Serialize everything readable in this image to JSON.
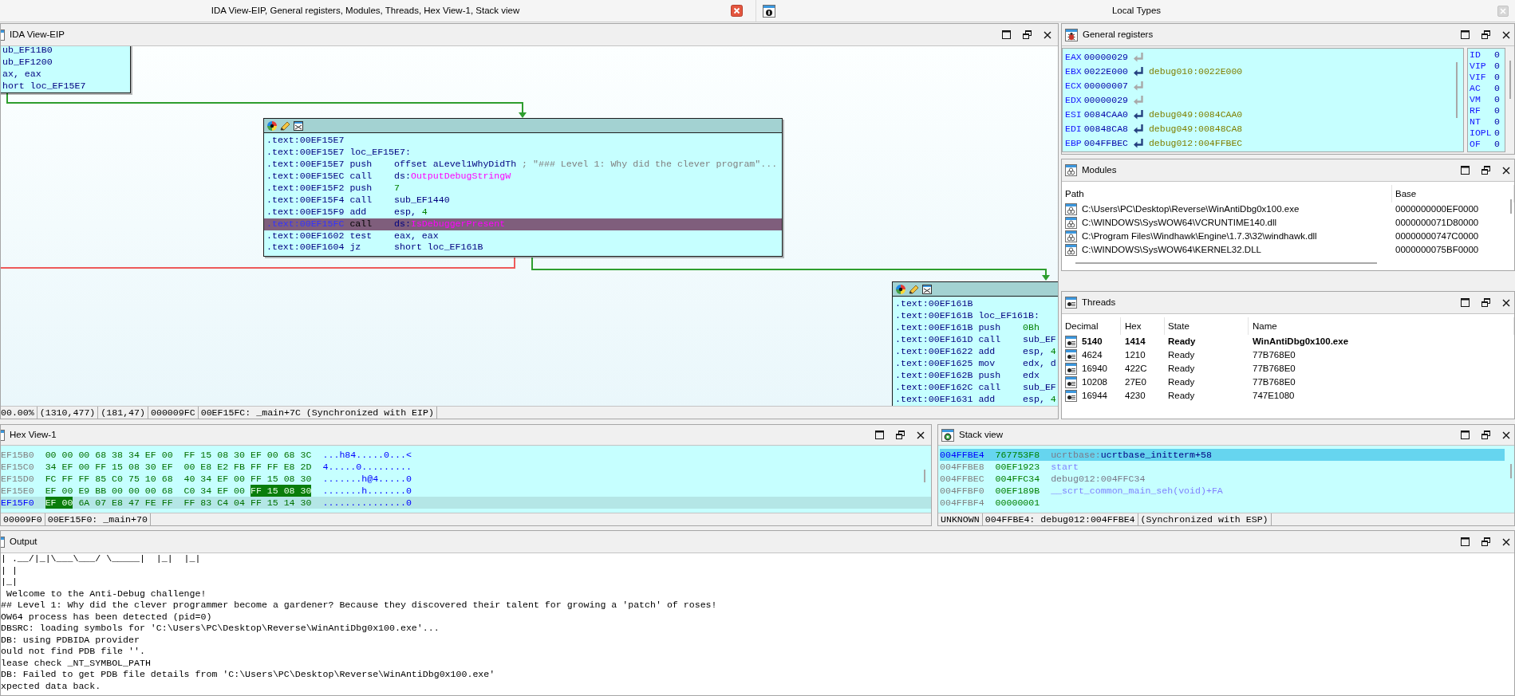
{
  "title_bar": {
    "title": "IDA View-EIP, General registers, Modules, Threads, Hex View-1, Stack view"
  },
  "local_types_bar": {
    "title": "Local Types"
  },
  "ida_view": {
    "title": "IDA View-EIP",
    "nodes": [
      {
        "kind": "clipped",
        "lines": [
          {
            "operands": [
              {
                "text": "ub_EF11B0",
                "kind": "name"
              }
            ],
            "selected": false
          },
          {
            "operands": [
              {
                "text": "ub_EF1200",
                "kind": "name"
              }
            ],
            "selected": false
          },
          {
            "operands": [
              {
                "text": "ax, eax",
                "kind": "name"
              }
            ],
            "selected": false
          },
          {
            "operands": [
              {
                "text": "hort loc_EF15E7",
                "kind": "name"
              }
            ],
            "selected": false
          }
        ]
      },
      {
        "kind": "block",
        "lines": [
          {
            "address": ".text:00EF15E7",
            "selected": false
          },
          {
            "address": ".text:00EF15E7",
            "label": "loc_EF15E7:",
            "selected": false
          },
          {
            "address": ".text:00EF15E7",
            "mnemonic": "push",
            "operands": [
              {
                "text": "offset aLevel1WhyDidTh",
                "kind": "name"
              }
            ],
            "comment": "; \"### Level 1: Why did the clever program\"...",
            "selected": false
          },
          {
            "address": ".text:00EF15EC",
            "mnemonic": "call",
            "operands": [
              {
                "text": "ds:",
                "kind": "name"
              },
              {
                "text": "OutputDebugStringW",
                "kind": "import"
              }
            ],
            "selected": false
          },
          {
            "address": ".text:00EF15F2",
            "mnemonic": "push",
            "operands": [
              {
                "text": "7",
                "kind": "number"
              }
            ],
            "selected": false
          },
          {
            "address": ".text:00EF15F4",
            "mnemonic": "call",
            "operands": [
              {
                "text": "sub_EF1440",
                "kind": "name"
              }
            ],
            "selected": false
          },
          {
            "address": ".text:00EF15F9",
            "mnemonic": "add",
            "operands": [
              {
                "text": "esp, ",
                "kind": "name"
              },
              {
                "text": "4",
                "kind": "number"
              }
            ],
            "selected": false
          },
          {
            "address": ".text:00EF15FC",
            "mnemonic": "call",
            "operands": [
              {
                "text": "ds:",
                "kind": "name"
              },
              {
                "text": "IsDebuggerPresent",
                "kind": "import"
              }
            ],
            "selected": true
          },
          {
            "address": ".text:00EF1602",
            "mnemonic": "test",
            "operands": [
              {
                "text": "eax, eax",
                "kind": "name"
              }
            ],
            "selected": false
          },
          {
            "address": ".text:00EF1604",
            "mnemonic": "jz",
            "operands": [
              {
                "text": "short loc_EF161B",
                "kind": "name"
              }
            ],
            "selected": false
          }
        ]
      },
      {
        "kind": "block",
        "lines": [
          {
            "address": ".text:00EF161B",
            "selected": false
          },
          {
            "address": ".text:00EF161B",
            "label": "loc_EF161B:",
            "selected": false
          },
          {
            "address": ".text:00EF161B",
            "mnemonic": "push",
            "operands": [
              {
                "text": "0Bh",
                "kind": "number"
              }
            ],
            "selected": false
          },
          {
            "address": ".text:00EF161D",
            "mnemonic": "call",
            "operands": [
              {
                "text": "sub_EF",
                "kind": "name"
              }
            ],
            "selected": false
          },
          {
            "address": ".text:00EF1622",
            "mnemonic": "add",
            "operands": [
              {
                "text": "esp, ",
                "kind": "name"
              },
              {
                "text": "4",
                "kind": "number"
              }
            ],
            "selected": false
          },
          {
            "address": ".text:00EF1625",
            "mnemonic": "mov",
            "operands": [
              {
                "text": "edx, d",
                "kind": "name"
              }
            ],
            "selected": false
          },
          {
            "address": ".text:00EF162B",
            "mnemonic": "push",
            "operands": [
              {
                "text": "edx",
                "kind": "name"
              }
            ],
            "selected": false
          },
          {
            "address": ".text:00EF162C",
            "mnemonic": "call",
            "operands": [
              {
                "text": "sub_EF",
                "kind": "name"
              }
            ],
            "selected": false
          },
          {
            "address": ".text:00EF1631",
            "mnemonic": "add",
            "operands": [
              {
                "text": "esp, ",
                "kind": "name"
              },
              {
                "text": "4",
                "kind": "number"
              }
            ],
            "selected": false
          }
        ]
      }
    ],
    "edges": [
      {
        "kind": "arrow",
        "color": "#2e9e2e"
      },
      {
        "kind": "line",
        "color": "#ee5a5a"
      },
      {
        "kind": "arrow",
        "color": "#2e9e2e"
      }
    ],
    "status_bar": [
      "00.00%",
      "(1310,477)",
      "(181,47)",
      "000009FC",
      "00EF15FC: _main+7C (Synchronized with EIP)"
    ]
  },
  "general_registers": {
    "title": "General registers",
    "registers": [
      {
        "name": "EAX",
        "value": "00000029",
        "disabled": true
      },
      {
        "name": "EBX",
        "value": "0022E000",
        "disabled": false,
        "target": "debug010:0022E000"
      },
      {
        "name": "ECX",
        "value": "00000007",
        "disabled": true
      },
      {
        "name": "EDX",
        "value": "00000029",
        "disabled": true
      },
      {
        "name": "ESI",
        "value": "0084CAA0",
        "disabled": false,
        "target": "debug049:0084CAA0"
      },
      {
        "name": "EDI",
        "value": "00848CA8",
        "disabled": false,
        "target": "debug049:00848CA8"
      },
      {
        "name": "EBP",
        "value": "004FFBEC",
        "disabled": false,
        "target": "debug012:004FFBEC"
      }
    ],
    "flags": [
      {
        "name": "ID",
        "value": "0"
      },
      {
        "name": "VIP",
        "value": "0"
      },
      {
        "name": "VIF",
        "value": "0"
      },
      {
        "name": "AC",
        "value": "0"
      },
      {
        "name": "VM",
        "value": "0"
      },
      {
        "name": "RF",
        "value": "0"
      },
      {
        "name": "NT",
        "value": "0"
      },
      {
        "name": "IOPL",
        "value": "0"
      },
      {
        "name": "OF",
        "value": "0"
      }
    ]
  },
  "modules": {
    "title": "Modules",
    "columns": [
      "Path",
      "Base"
    ],
    "rows": [
      {
        "path": "C:\\Users\\PC\\Desktop\\Reverse\\WinAntiDbg0x100.exe",
        "base": "0000000000EF0000"
      },
      {
        "path": "C:\\WINDOWS\\SysWOW64\\VCRUNTIME140.dll",
        "base": "0000000071D80000"
      },
      {
        "path": "C:\\Program Files\\Windhawk\\Engine\\1.7.3\\32\\windhawk.dll",
        "base": "00000000747C0000"
      },
      {
        "path": "C:\\WINDOWS\\SysWOW64\\KERNEL32.DLL",
        "base": "0000000075BF0000"
      }
    ]
  },
  "threads": {
    "title": "Threads",
    "columns": [
      "Decimal",
      "Hex",
      "State",
      "Name"
    ],
    "rows": [
      {
        "decimal": "5140",
        "hex": "1414",
        "state": "Ready",
        "name": "WinAntiDbg0x100.exe",
        "current": true
      },
      {
        "decimal": "4624",
        "hex": "1210",
        "state": "Ready",
        "name": "77B768E0",
        "current": false
      },
      {
        "decimal": "16940",
        "hex": "422C",
        "state": "Ready",
        "name": "77B768E0",
        "current": false
      },
      {
        "decimal": "10208",
        "hex": "27E0",
        "state": "Ready",
        "name": "77B768E0",
        "current": false
      },
      {
        "decimal": "16944",
        "hex": "4230",
        "state": "Ready",
        "name": "747E1080",
        "current": false
      }
    ]
  },
  "hex_view": {
    "title": "Hex View-1",
    "rows": [
      {
        "address": "EF15B0",
        "selected": false,
        "ascii": "...h84.....0...<",
        "bytes": [
          {
            "text": "00",
            "highlighted": false
          },
          {
            "text": "00",
            "highlighted": false
          },
          {
            "text": "00",
            "highlighted": false
          },
          {
            "text": "68",
            "highlighted": false
          },
          {
            "text": "38",
            "highlighted": false
          },
          {
            "text": "34",
            "highlighted": false
          },
          {
            "text": "EF",
            "highlighted": false
          },
          {
            "text": "00",
            "highlighted": false
          },
          {
            "text": "FF",
            "highlighted": false
          },
          {
            "text": "15",
            "highlighted": false
          },
          {
            "text": "08",
            "highlighted": false
          },
          {
            "text": "30",
            "highlighted": false
          },
          {
            "text": "EF",
            "highlighted": false
          },
          {
            "text": "00",
            "highlighted": false
          },
          {
            "text": "68",
            "highlighted": false
          },
          {
            "text": "3C",
            "highlighted": false
          }
        ]
      },
      {
        "address": "EF15C0",
        "selected": false,
        "ascii": "4.....0.........",
        "bytes": [
          {
            "text": "34",
            "highlighted": false
          },
          {
            "text": "EF",
            "highlighted": false
          },
          {
            "text": "00",
            "highlighted": false
          },
          {
            "text": "FF",
            "highlighted": false
          },
          {
            "text": "15",
            "highlighted": false
          },
          {
            "text": "08",
            "highlighted": false
          },
          {
            "text": "30",
            "highlighted": false
          },
          {
            "text": "EF",
            "highlighted": false
          },
          {
            "text": "00",
            "highlighted": false
          },
          {
            "text": "E8",
            "highlighted": false
          },
          {
            "text": "E2",
            "highlighted": false
          },
          {
            "text": "FB",
            "highlighted": false
          },
          {
            "text": "FF",
            "highlighted": false
          },
          {
            "text": "FF",
            "highlighted": false
          },
          {
            "text": "E8",
            "highlighted": false
          },
          {
            "text": "2D",
            "highlighted": false
          }
        ]
      },
      {
        "address": "EF15D0",
        "selected": false,
        "ascii": ".......h@4.....0",
        "bytes": [
          {
            "text": "FC",
            "highlighted": false
          },
          {
            "text": "FF",
            "highlighted": false
          },
          {
            "text": "FF",
            "highlighted": false
          },
          {
            "text": "85",
            "highlighted": false
          },
          {
            "text": "C0",
            "highlighted": false
          },
          {
            "text": "75",
            "highlighted": false
          },
          {
            "text": "10",
            "highlighted": false
          },
          {
            "text": "68",
            "highlighted": false
          },
          {
            "text": "40",
            "highlighted": false
          },
          {
            "text": "34",
            "highlighted": false
          },
          {
            "text": "EF",
            "highlighted": false
          },
          {
            "text": "00",
            "highlighted": false
          },
          {
            "text": "FF",
            "highlighted": false
          },
          {
            "text": "15",
            "highlighted": false
          },
          {
            "text": "08",
            "highlighted": false
          },
          {
            "text": "30",
            "highlighted": false
          }
        ]
      },
      {
        "address": "EF15E0",
        "selected": false,
        "ascii": ".......h.......0",
        "bytes": [
          {
            "text": "EF",
            "highlighted": false
          },
          {
            "text": "00",
            "highlighted": false
          },
          {
            "text": "E9",
            "highlighted": false
          },
          {
            "text": "BB",
            "highlighted": false
          },
          {
            "text": "00",
            "highlighted": false
          },
          {
            "text": "00",
            "highlighted": false
          },
          {
            "text": "00",
            "highlighted": false
          },
          {
            "text": "68",
            "highlighted": false
          },
          {
            "text": "C0",
            "highlighted": false
          },
          {
            "text": "34",
            "highlighted": false
          },
          {
            "text": "EF",
            "highlighted": false
          },
          {
            "text": "00",
            "highlighted": false
          },
          {
            "text": "FF",
            "highlighted": true
          },
          {
            "text": "15",
            "highlighted": true
          },
          {
            "text": "08",
            "highlighted": true
          },
          {
            "text": "30",
            "highlighted": true
          }
        ]
      },
      {
        "address": "EF15F0",
        "selected": true,
        "ascii": "...............0",
        "bytes": [
          {
            "text": "EF",
            "highlighted": true
          },
          {
            "text": "00",
            "highlighted": true
          },
          {
            "text": "6A",
            "highlighted": false
          },
          {
            "text": "07",
            "highlighted": false
          },
          {
            "text": "E8",
            "highlighted": false
          },
          {
            "text": "47",
            "highlighted": false
          },
          {
            "text": "FE",
            "highlighted": false
          },
          {
            "text": "FF",
            "highlighted": false
          },
          {
            "text": "FF",
            "highlighted": false
          },
          {
            "text": "83",
            "highlighted": false
          },
          {
            "text": "C4",
            "highlighted": false
          },
          {
            "text": "04",
            "highlighted": false
          },
          {
            "text": "FF",
            "highlighted": false
          },
          {
            "text": "15",
            "highlighted": false
          },
          {
            "text": "14",
            "highlighted": false
          },
          {
            "text": "30",
            "highlighted": false
          }
        ]
      }
    ],
    "status_bar": [
      "00009F0",
      "00EF15F0: _main+70"
    ]
  },
  "stack_view": {
    "title": "Stack view",
    "rows": [
      {
        "address": "004FFBE4",
        "value": "767753F8",
        "symbol": [
          {
            "text": "ucrtbase:",
            "kind": "segment"
          },
          {
            "text": "ucrtbase_initterm+58",
            "kind": "name"
          }
        ],
        "selected": true
      },
      {
        "address": "004FFBE8",
        "value": "00EF1923",
        "symbol": [
          {
            "text": "start",
            "kind": "function"
          }
        ],
        "selected": false
      },
      {
        "address": "004FFBEC",
        "value": "004FFC34",
        "symbol": [
          {
            "text": "debug012:004FFC34",
            "kind": "segment"
          }
        ],
        "selected": false
      },
      {
        "address": "004FFBF0",
        "value": "00EF189B",
        "symbol": [
          {
            "text": "__scrt_common_main_seh(void)+FA",
            "kind": "function"
          }
        ],
        "selected": false
      },
      {
        "address": "004FFBF4",
        "value": "00000001",
        "selected": false
      }
    ],
    "status_bar": [
      "UNKNOWN",
      "004FFBE4: debug012:004FFBE4",
      "(Synchronized with ESP)"
    ]
  },
  "output": {
    "title": "Output",
    "lines": [
      "| .__/|_|\\___\\___/ \\_____|  |_|  |_|",
      "| |",
      "|_|",
      " Welcome to the Anti-Debug challenge!",
      "## Level 1: Why did the clever programmer become a gardener? Because they discovered their talent for growing a 'patch' of roses!",
      "OW64 process has been detected (pid=0)",
      "DBSRC: loading symbols for 'C:\\Users\\PC\\Desktop\\Reverse\\WinAntiDbg0x100.exe'...",
      "DB: using PDBIDA provider",
      "ould not find PDB file ''.",
      "lease check _NT_SYMBOL_PATH",
      "DB: Failed to get PDB file details from 'C:\\Users\\PC\\Desktop\\Reverse\\WinAntiDbg0x100.exe'",
      "xpected data back."
    ]
  }
}
